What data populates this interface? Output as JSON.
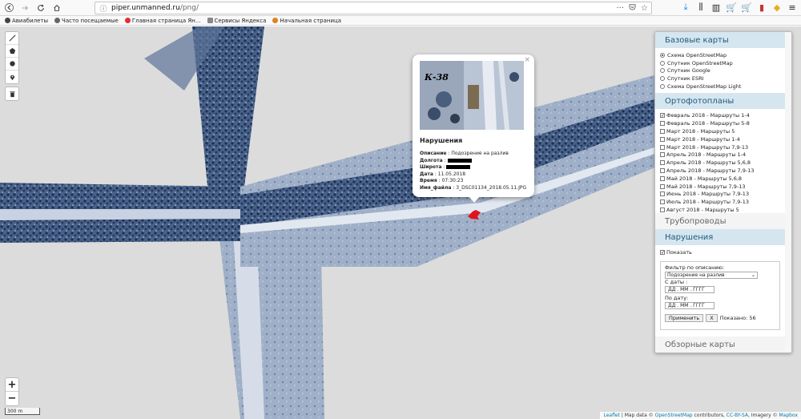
{
  "browser": {
    "url_host": "piper.unmanned.ru",
    "url_path": "/png/",
    "menu_dots": "···",
    "bookmarks": [
      {
        "label": "Авиабилеты",
        "color": "#444"
      },
      {
        "label": "Часто посещаемые",
        "color": "#666"
      },
      {
        "label": "Главная страница Ян...",
        "color": "#e03030"
      },
      {
        "label": "Сервисы Яндекса",
        "color": "#888"
      },
      {
        "label": "Начальная страница",
        "color": "#e08020"
      }
    ]
  },
  "map": {
    "scale_label": "300 m",
    "zoom_in": "+",
    "zoom_out": "−",
    "attribution": {
      "leaflet": "Leaflet",
      "text1": " | Map data © ",
      "osm": "OpenStreetMap",
      "text2": " contributors, ",
      "license": "CC-BY-SA",
      "text3": ", Imagery © ",
      "mapbox": "Mapbox"
    }
  },
  "popup": {
    "close": "×",
    "photo_label": "К-38",
    "title": "Нарушения",
    "rows": [
      {
        "key": "Описание",
        "value": "Подозрение на разлив"
      },
      {
        "key": "Долгота",
        "value": ""
      },
      {
        "key": "Широта",
        "value": ""
      },
      {
        "key": "Дата",
        "value": "11.05.2018"
      },
      {
        "key": "Время",
        "value": "07:30:23"
      },
      {
        "key": "Имя_файла",
        "value": "3_DSC01134_2018.05.11.JPG"
      }
    ]
  },
  "panel": {
    "base_maps_title": "Базовые карты",
    "base_maps": [
      {
        "label": "Схема OpenStreetMap",
        "selected": true
      },
      {
        "label": "Спутник OpenStreetMap",
        "selected": false
      },
      {
        "label": "Спутник Google",
        "selected": false
      },
      {
        "label": "Спутник ESRI",
        "selected": false
      },
      {
        "label": "Схема OpenStreetMap Light",
        "selected": false
      }
    ],
    "ortho_title": "Ортофотопланы",
    "ortho": [
      {
        "label": "Февраль 2018 - Маршруты 1-4",
        "checked": true
      },
      {
        "label": "Февраль 2018 - Маршруты 5-8",
        "checked": false
      },
      {
        "label": "Март 2018 - Маршруты 5",
        "checked": false
      },
      {
        "label": "Март 2018 - Маршруты 1-4",
        "checked": false
      },
      {
        "label": "Март 2018 - Маршруты 7,9-13",
        "checked": false
      },
      {
        "label": "Апрель 2018 - Маршруты 1-4",
        "checked": false
      },
      {
        "label": "Апрель 2018 - Маршруты 5,6,8",
        "checked": false
      },
      {
        "label": "Апрель 2018 - Маршруты 7,9-13",
        "checked": false
      },
      {
        "label": "Май 2018 - Маршруты 5,6,8",
        "checked": false
      },
      {
        "label": "Май 2018 - Маршруты 7,9-13",
        "checked": false
      },
      {
        "label": "Июнь 2018 - Маршруты 7,9-13",
        "checked": false
      },
      {
        "label": "Июль 2018 - Маршруты 7,9-13",
        "checked": false
      },
      {
        "label": "Август 2018 - Маршруты 5",
        "checked": false
      }
    ],
    "pipelines_title": "Трубопроводы",
    "violations_title": "Нарушения",
    "show_label": "Показать",
    "filter_label": "Фильтр по описанию:",
    "filter_value": "Подозрение на разлив",
    "from_label": "С даты :",
    "from_placeholder": "ДД . ММ . ГГГГ",
    "to_label": "По дату:",
    "to_placeholder": "ДД . ММ . ГГГГ",
    "apply_label": "Применить",
    "clear_label": "X",
    "shown_label": "Показано: 56",
    "overview_title": "Обзорные карты"
  }
}
